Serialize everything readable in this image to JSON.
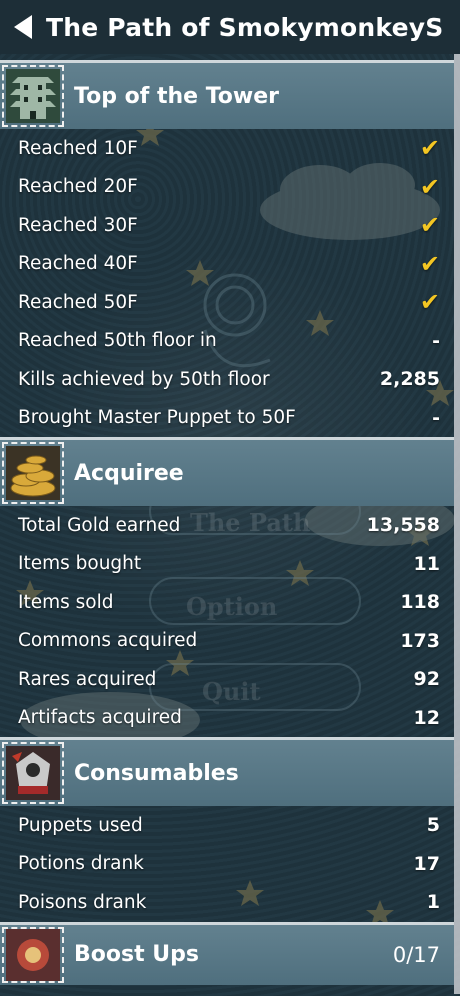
{
  "header": {
    "title": "The Path of SmokymonkeyS",
    "back_icon": "back-arrow-icon"
  },
  "sections": {
    "tower": {
      "title": "Top of the Tower",
      "icon": "pagoda-tower-icon",
      "rows": [
        {
          "label": "Reached 10F",
          "value": "✔"
        },
        {
          "label": "Reached 20F",
          "value": "✔"
        },
        {
          "label": "Reached 30F",
          "value": "✔"
        },
        {
          "label": "Reached 40F",
          "value": "✔"
        },
        {
          "label": "Reached 50F",
          "value": "✔"
        },
        {
          "label": "Reached 50th floor in",
          "value": "-"
        },
        {
          "label": "Kills achieved by 50th floor",
          "value": "2,285"
        },
        {
          "label": "Brought Master Puppet to 50F",
          "value": "-"
        }
      ]
    },
    "acquiree": {
      "title": "Acquiree",
      "icon": "gold-coins-icon",
      "rows": [
        {
          "label": "Total Gold earned",
          "value": "13,558"
        },
        {
          "label": "Items bought",
          "value": "11"
        },
        {
          "label": "Items sold",
          "value": "118"
        },
        {
          "label": "Commons acquired",
          "value": "173"
        },
        {
          "label": "Rares acquired",
          "value": "92"
        },
        {
          "label": "Artifacts acquired",
          "value": "12"
        }
      ]
    },
    "consumables": {
      "title": "Consumables",
      "icon": "puppet-figure-icon",
      "rows": [
        {
          "label": "Puppets used",
          "value": "5"
        },
        {
          "label": "Potions drank",
          "value": "17"
        },
        {
          "label": "Poisons drank",
          "value": "1"
        }
      ]
    },
    "boost": {
      "title": "Boost Ups",
      "icon": "boost-item-icon",
      "count": "0/17"
    }
  },
  "background_text": {
    "path": "The Path",
    "option": "Option",
    "quit": "Quit"
  },
  "colors": {
    "check": "#f3c623",
    "header_bg": "#56788a",
    "page_bg": "#1f343e"
  }
}
